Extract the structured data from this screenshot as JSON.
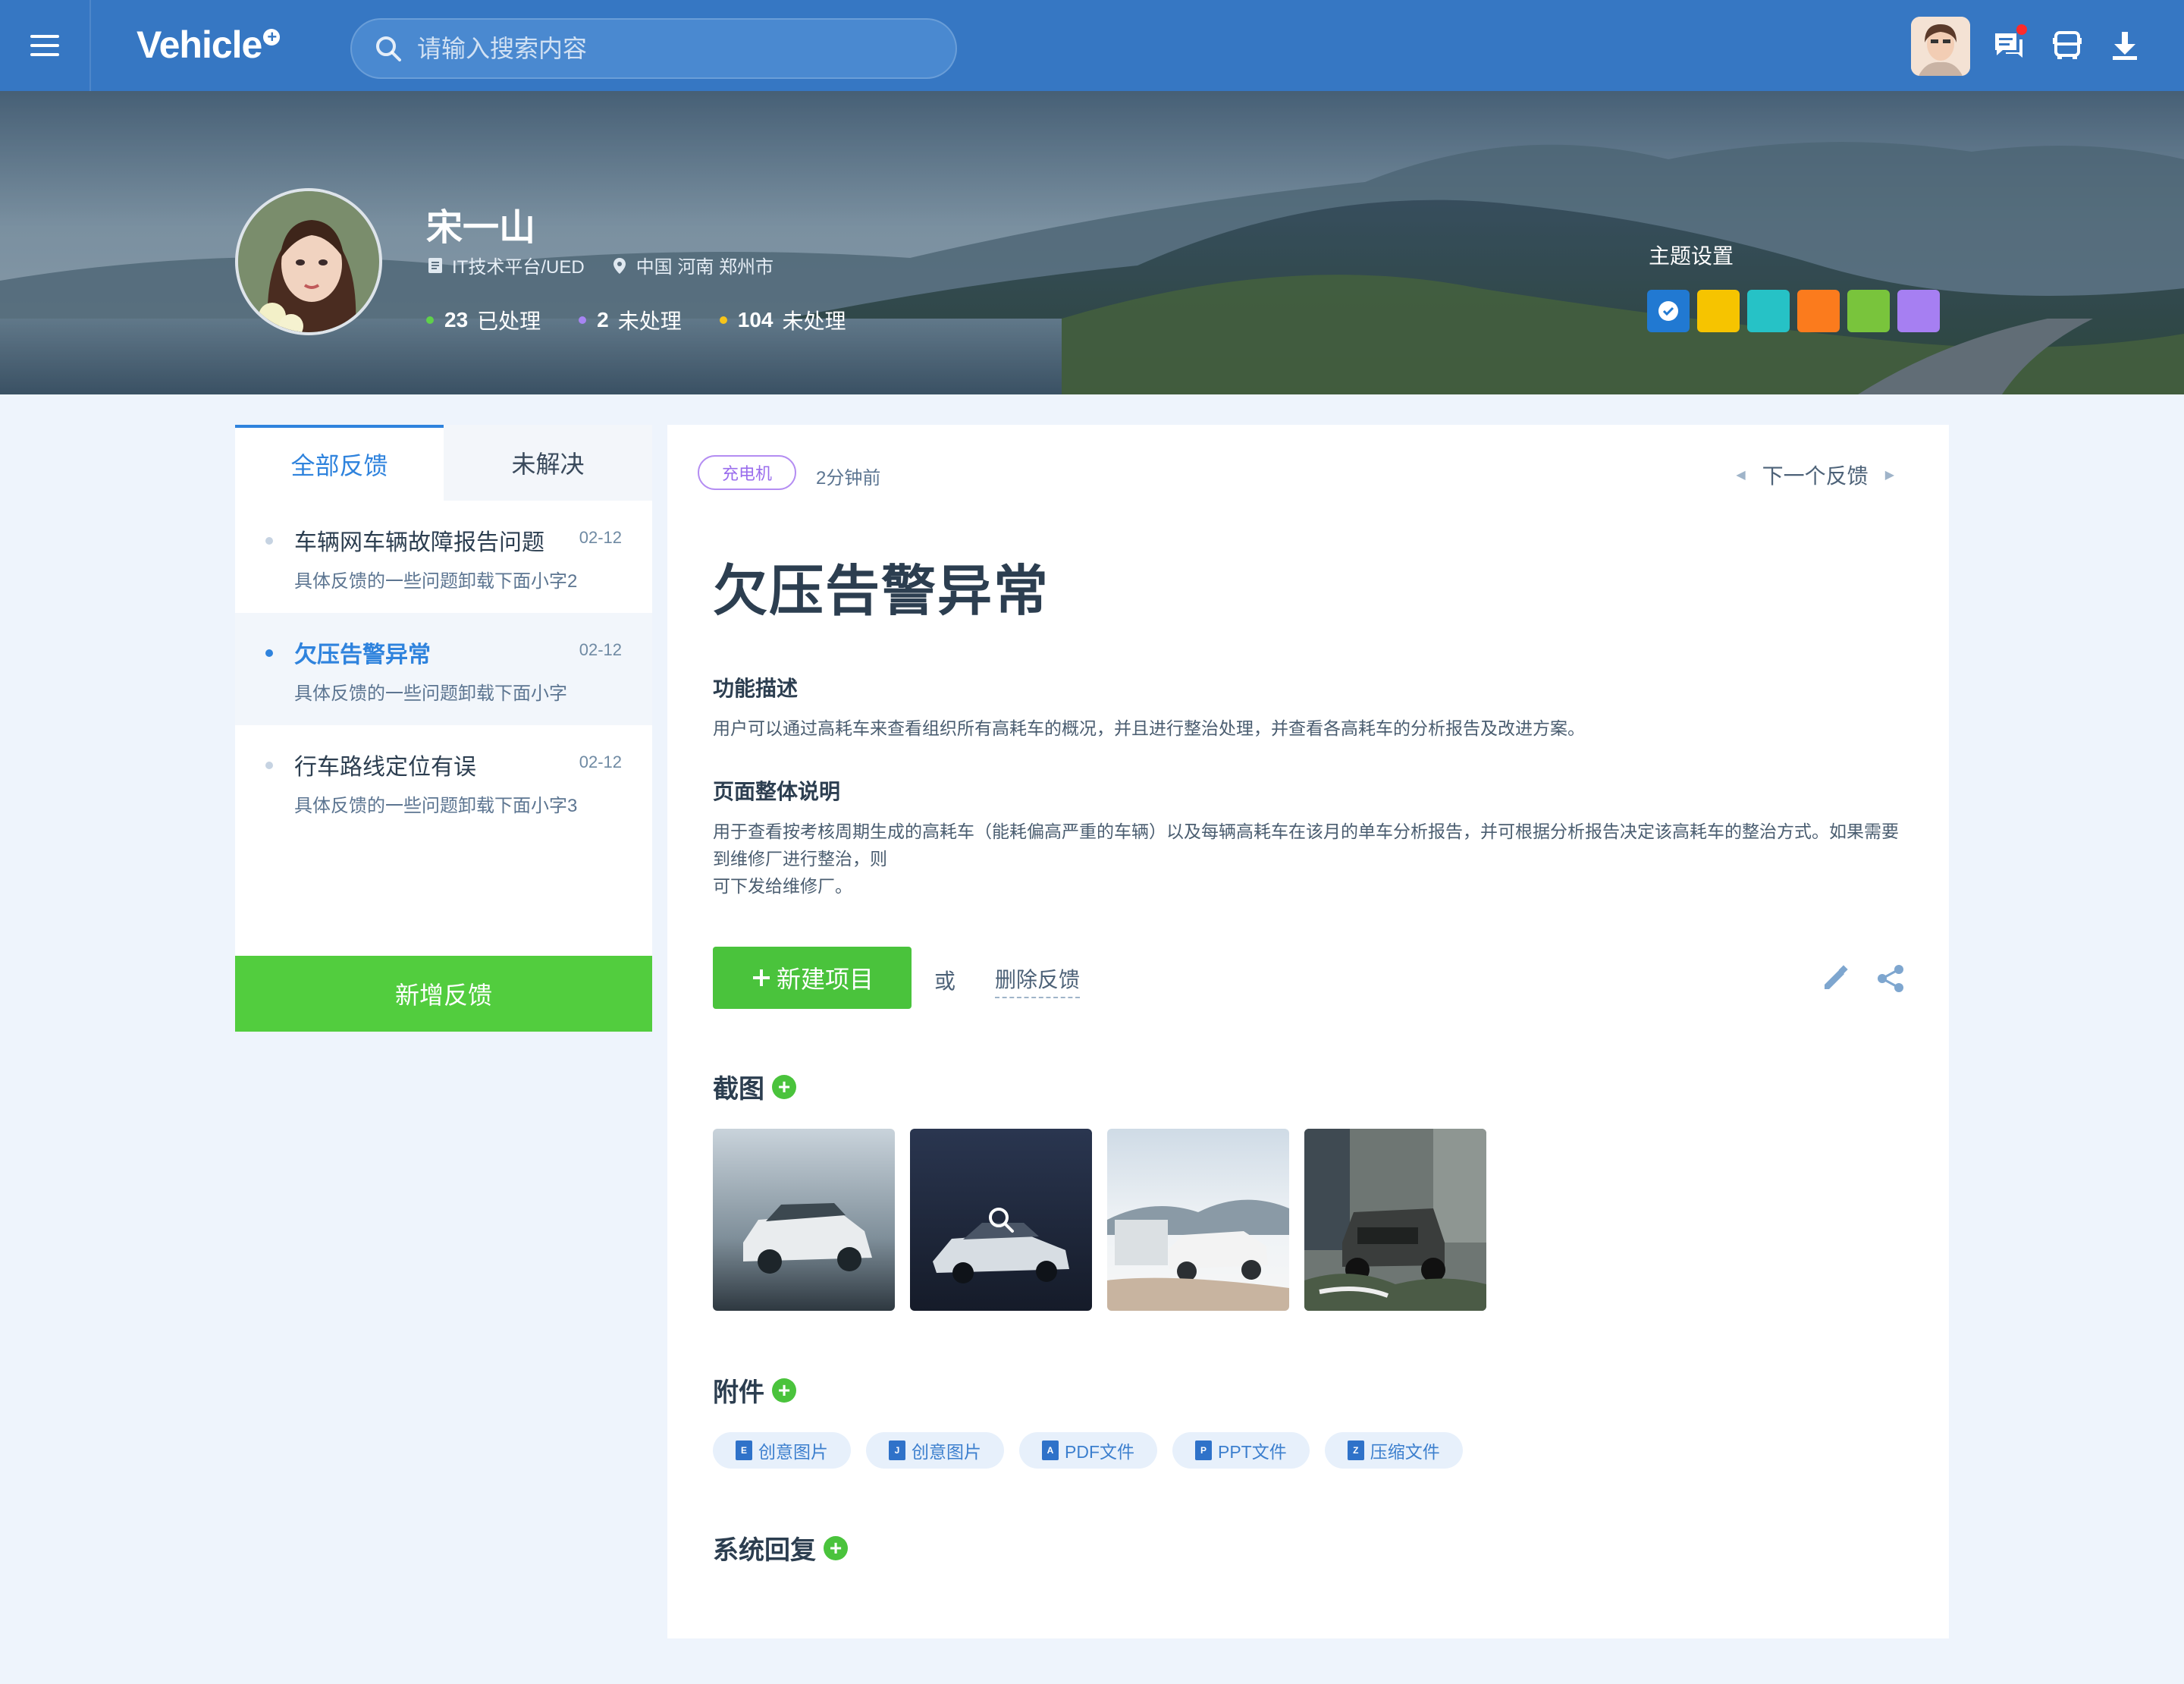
{
  "header": {
    "logo": "Vehicle",
    "search_placeholder": "请输入搜索内容"
  },
  "profile": {
    "name": "宋一山",
    "department": "IT技术平台/UED",
    "location": "中国 河南 郑州市",
    "stats": [
      {
        "value": "23",
        "label": "已处理",
        "color": "#5fd04a"
      },
      {
        "value": "2",
        "label": "未处理",
        "color": "#a785f3"
      },
      {
        "value": "104",
        "label": "未处理",
        "color": "#f6c41a"
      }
    ],
    "theme_title": "主题设置",
    "theme_colors": [
      "#2179d2",
      "#f6c400",
      "#26c2c6",
      "#fb7b1d",
      "#79c43c",
      "#a67ff2"
    ]
  },
  "sidebar": {
    "tabs": [
      "全部反馈",
      "未解决"
    ],
    "items": [
      {
        "title": "车辆网车辆故障报告问题",
        "date": "02-12",
        "sub": "具体反馈的一些问题卸载下面小字2"
      },
      {
        "title": "欠压告警异常",
        "date": "02-12",
        "sub": "具体反馈的一些问题卸载下面小字"
      },
      {
        "title": "行车路线定位有误",
        "date": "02-12",
        "sub": "具体反馈的一些问题卸载下面小字3"
      }
    ],
    "add_button": "新增反馈"
  },
  "detail": {
    "tag": "充电机",
    "time": "2分钟前",
    "next_label": "下一个反馈",
    "title": "欠压告警异常",
    "sections": [
      {
        "heading": "功能描述",
        "text": "用户可以通过高耗车来查看组织所有高耗车的概况，并且进行整治处理，并查看各高耗车的分析报告及改进方案。"
      },
      {
        "heading": "页面整体说明",
        "text": "用于查看按考核周期生成的高耗车（能耗偏高严重的车辆）以及每辆高耗车在该月的单车分析报告，并可根据分析报告决定该高耗车的整治方式。如果需要到维修厂进行整治，则\n可下发给维修厂。"
      }
    ],
    "new_project": "新建项目",
    "or": "或",
    "delete": "删除反馈",
    "screenshots_title": "截图",
    "attachments_title": "附件",
    "attachments": [
      {
        "name": "创意图片",
        "icon": "excel-file-icon"
      },
      {
        "name": "创意图片",
        "icon": "jpg-file-icon"
      },
      {
        "name": "PDF文件",
        "icon": "pdf-file-icon"
      },
      {
        "name": "PPT文件",
        "icon": "ppt-file-icon"
      },
      {
        "name": "压缩文件",
        "icon": "zip-file-icon"
      }
    ],
    "reply_title": "系统回复"
  }
}
